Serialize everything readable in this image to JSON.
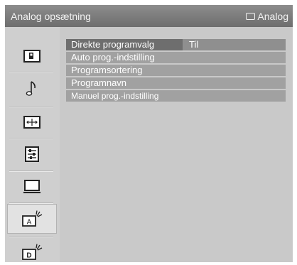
{
  "header": {
    "title": "Analog opsætning",
    "source_label": "Analog"
  },
  "sidebar": {
    "items": [
      {
        "icon": "picture-icon",
        "selected": false
      },
      {
        "icon": "music-note-icon",
        "selected": false
      },
      {
        "icon": "screen-format-icon",
        "selected": false
      },
      {
        "icon": "settings-list-icon",
        "selected": false
      },
      {
        "icon": "monitor-icon",
        "selected": false
      },
      {
        "icon": "analog-setup-icon",
        "label": "A",
        "selected": true
      },
      {
        "icon": "digital-setup-icon",
        "label": "D",
        "selected": false
      }
    ]
  },
  "menu": {
    "rows": [
      {
        "label": "Direkte programvalg",
        "value": "Til",
        "selected": true
      },
      {
        "label": "Auto prog.-indstilling"
      },
      {
        "label": "Programsortering"
      },
      {
        "label": "Programnavn"
      },
      {
        "label": "Manuel prog.-indstilling"
      }
    ]
  },
  "colors": {
    "header_bg": "#7a7a7a",
    "menu_row": "#a1a1a1",
    "menu_row_selected": "#6e6e6e",
    "panel_bg": "#cfcfcf"
  }
}
